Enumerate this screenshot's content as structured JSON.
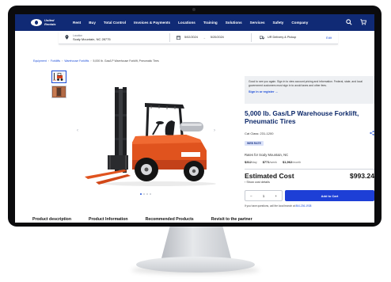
{
  "brand": {
    "logo_text": "United Rentals",
    "accent": "#102a75",
    "cta": "#1d3fd6"
  },
  "nav": {
    "links": [
      "Rent",
      "Buy",
      "Total Control",
      "Invoices & Payments",
      "Locations",
      "Training",
      "Solutions",
      "Services",
      "Safety",
      "Company"
    ],
    "icons": [
      "search-icon",
      "cart-icon"
    ]
  },
  "location_bar": {
    "location_label": "Location",
    "location_value": "Scaly Mountain, NC 28775",
    "date_start": "5/02/2024",
    "date_end": "5/20/2024",
    "delivery": "UR Delivery & Pickup",
    "edit_label": "Edit"
  },
  "breadcrumb": [
    "Equipment",
    "Forklifts",
    "Warehouse Forklifts",
    "5,000 lb. Gas/LP Warehouse Forklift, Pneumatic Tires"
  ],
  "promo": {
    "text": "Good to see you again. Sign in to view account pricing and information. Federal, state, and local government customers must sign in to avoid taxes and other fees.",
    "signin_label": "Sign in or register →"
  },
  "product": {
    "title": "5,000 lb. Gas/LP Warehouse Forklift, Pneumatic Tires",
    "cat_class": "Cat Class: 231-1200",
    "badge": "WEB RATE",
    "rates_for": "Rates for Scaly Mountain, NC",
    "rates": [
      {
        "amount": "$312",
        "unit": "/day"
      },
      {
        "amount": "$771",
        "unit": "/week"
      },
      {
        "amount": "$1,962",
        "unit": "/month"
      }
    ]
  },
  "estimate": {
    "label": "Estimated Cost",
    "value": "$993.24",
    "show_details": "Show cost details"
  },
  "cart": {
    "minus": "−",
    "qty": "1",
    "plus": "+",
    "add_label": "Add to Cart"
  },
  "questions": {
    "text": "If you have questions, call the local branch at",
    "phone": "864-236-1938"
  },
  "tabs": [
    "Product description",
    "Product Information",
    "Recommended Products",
    "Revisit to the partner"
  ]
}
